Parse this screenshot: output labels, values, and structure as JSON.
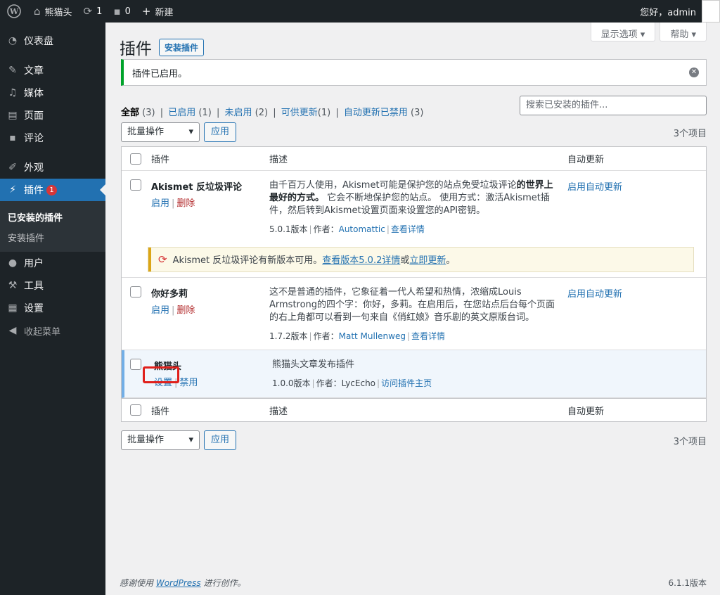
{
  "adminbar": {
    "site_name": "熊猫头",
    "updates_count": "1",
    "comments_count": "0",
    "new_label": "新建",
    "greeting": "您好，admin"
  },
  "sidebar": {
    "items": [
      {
        "label": "仪表盘",
        "icon": "dashboard-icon"
      },
      {
        "label": "文章",
        "icon": "pin-icon"
      },
      {
        "label": "媒体",
        "icon": "media-icon"
      },
      {
        "label": "页面",
        "icon": "page-icon"
      },
      {
        "label": "评论",
        "icon": "comment-icon"
      },
      {
        "label": "外观",
        "icon": "brush-icon"
      },
      {
        "label": "插件",
        "icon": "plugin-icon",
        "badge": "1"
      },
      {
        "label": "用户",
        "icon": "user-icon"
      },
      {
        "label": "工具",
        "icon": "wrench-icon"
      },
      {
        "label": "设置",
        "icon": "settings-icon"
      },
      {
        "label": "收起菜单",
        "icon": "collapse-icon"
      }
    ],
    "submenu": [
      "已安装的插件",
      "安装插件"
    ]
  },
  "screen_tabs": {
    "options": "显示选项 ▾",
    "help": "帮助 ▾"
  },
  "page": {
    "title": "插件",
    "add_new": "安装插件"
  },
  "notice": {
    "text": "插件已启用。"
  },
  "filters": {
    "all": "全部",
    "all_count": "(3)",
    "active": "已启用",
    "active_count": "(1)",
    "inactive": "未启用",
    "inactive_count": "(2)",
    "update": "可供更新",
    "update_count": "(1)",
    "auto_disabled": "自动更新已禁用",
    "auto_disabled_count": "(3)"
  },
  "search": {
    "placeholder": "搜索已安装的插件..."
  },
  "tablenav": {
    "bulk": "批量操作",
    "apply": "应用",
    "count": "3个项目"
  },
  "table": {
    "col_name": "插件",
    "col_desc": "描述",
    "col_auto": "自动更新",
    "plugins": [
      {
        "name": "Akismet 反垃圾评论",
        "action1": "启用",
        "action2": "删除",
        "desc_1": "由千百万人使用，Akismet可能是保护您的站点免受垃圾评论",
        "desc_bold": "的世界上最好的方式。",
        "desc_2": " 它会不断地保护您的站点。 使用方式：激活Akismet插件，然后转到Akismet设置页面来设置您的API密钥。",
        "version": "5.0.1版本",
        "author_label": "作者：",
        "author": "Automattic",
        "details": "查看详情",
        "auto": "启用自动更新"
      },
      {
        "name": "你好多莉",
        "action1": "启用",
        "action2": "删除",
        "desc_1": "这不是普通的插件，它象征着一代人希望和热情，浓缩成Louis Armstrong的四个字：你好，多莉。在启用后，在您站点后台每个页面的右上角都可以看到一句来自《俏红娘》音乐剧的英文原版台词。",
        "version": "1.7.2版本",
        "author_label": "作者：",
        "author": "Matt Mullenweg",
        "details": "查看详情",
        "auto": "启用自动更新"
      },
      {
        "name": "熊猫头",
        "action1": "设置",
        "action2": "禁用",
        "desc_1": "熊猫头文章发布插件",
        "version": "1.0.0版本",
        "author_label": "作者：",
        "author": "LycEcho",
        "details": "访问插件主页"
      }
    ],
    "update_notice": {
      "text": "Akismet 反垃圾评论有新版本可用。",
      "view_link": "查看版本5.0.2详情",
      "or": "或",
      "update_link": "立即更新",
      "end": "。"
    }
  },
  "footer": {
    "thanks_prefix": "感谢使用",
    "wp": "WordPress",
    "thanks_suffix": "进行创作。",
    "version": "6.1.1版本"
  }
}
